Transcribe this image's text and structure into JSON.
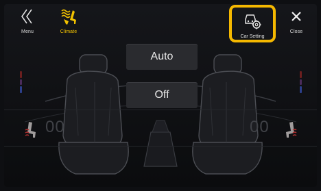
{
  "topbar": {
    "menu_label": "Menu",
    "climate_label": "Climate",
    "car_setting_label": "Car Setting",
    "close_label": "Close"
  },
  "climate": {
    "auto_label": "Auto",
    "off_label": "Off",
    "left_temp": "00",
    "right_temp": "00"
  },
  "colors": {
    "accent_yellow": "#f5b800",
    "climate_yellow": "#f2c200",
    "heat_red": "#c0392b",
    "cool_blue": "#3a5bd0"
  },
  "icons": [
    "chevron-left-icon",
    "climate-seat-icon",
    "car-setting-icon",
    "close-icon",
    "seat-heater-icon"
  ]
}
